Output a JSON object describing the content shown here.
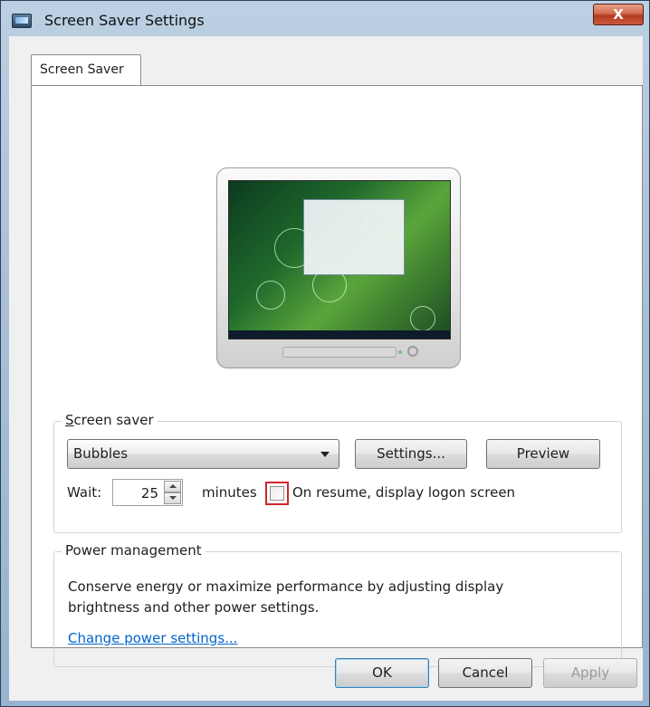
{
  "window": {
    "title": "Screen Saver Settings",
    "close_label": "X"
  },
  "tabs": [
    {
      "label": "Screen Saver",
      "selected": true
    }
  ],
  "preview": {
    "description": "monitor preview showing Bubbles screen saver"
  },
  "screen_saver": {
    "group_label": "Screen saver",
    "selected": "Bubbles",
    "settings_button": "Settings...",
    "preview_button": "Preview",
    "wait_label": "Wait:",
    "wait_value": "25",
    "minutes_label": "minutes",
    "resume_checkbox_label": "On resume, display logon screen",
    "resume_checked": false
  },
  "power_management": {
    "group_label": "Power management",
    "description": "Conserve energy or maximize performance by adjusting display brightness and other power settings.",
    "link": "Change power settings..."
  },
  "footer": {
    "ok": "OK",
    "cancel": "Cancel",
    "apply": "Apply"
  }
}
